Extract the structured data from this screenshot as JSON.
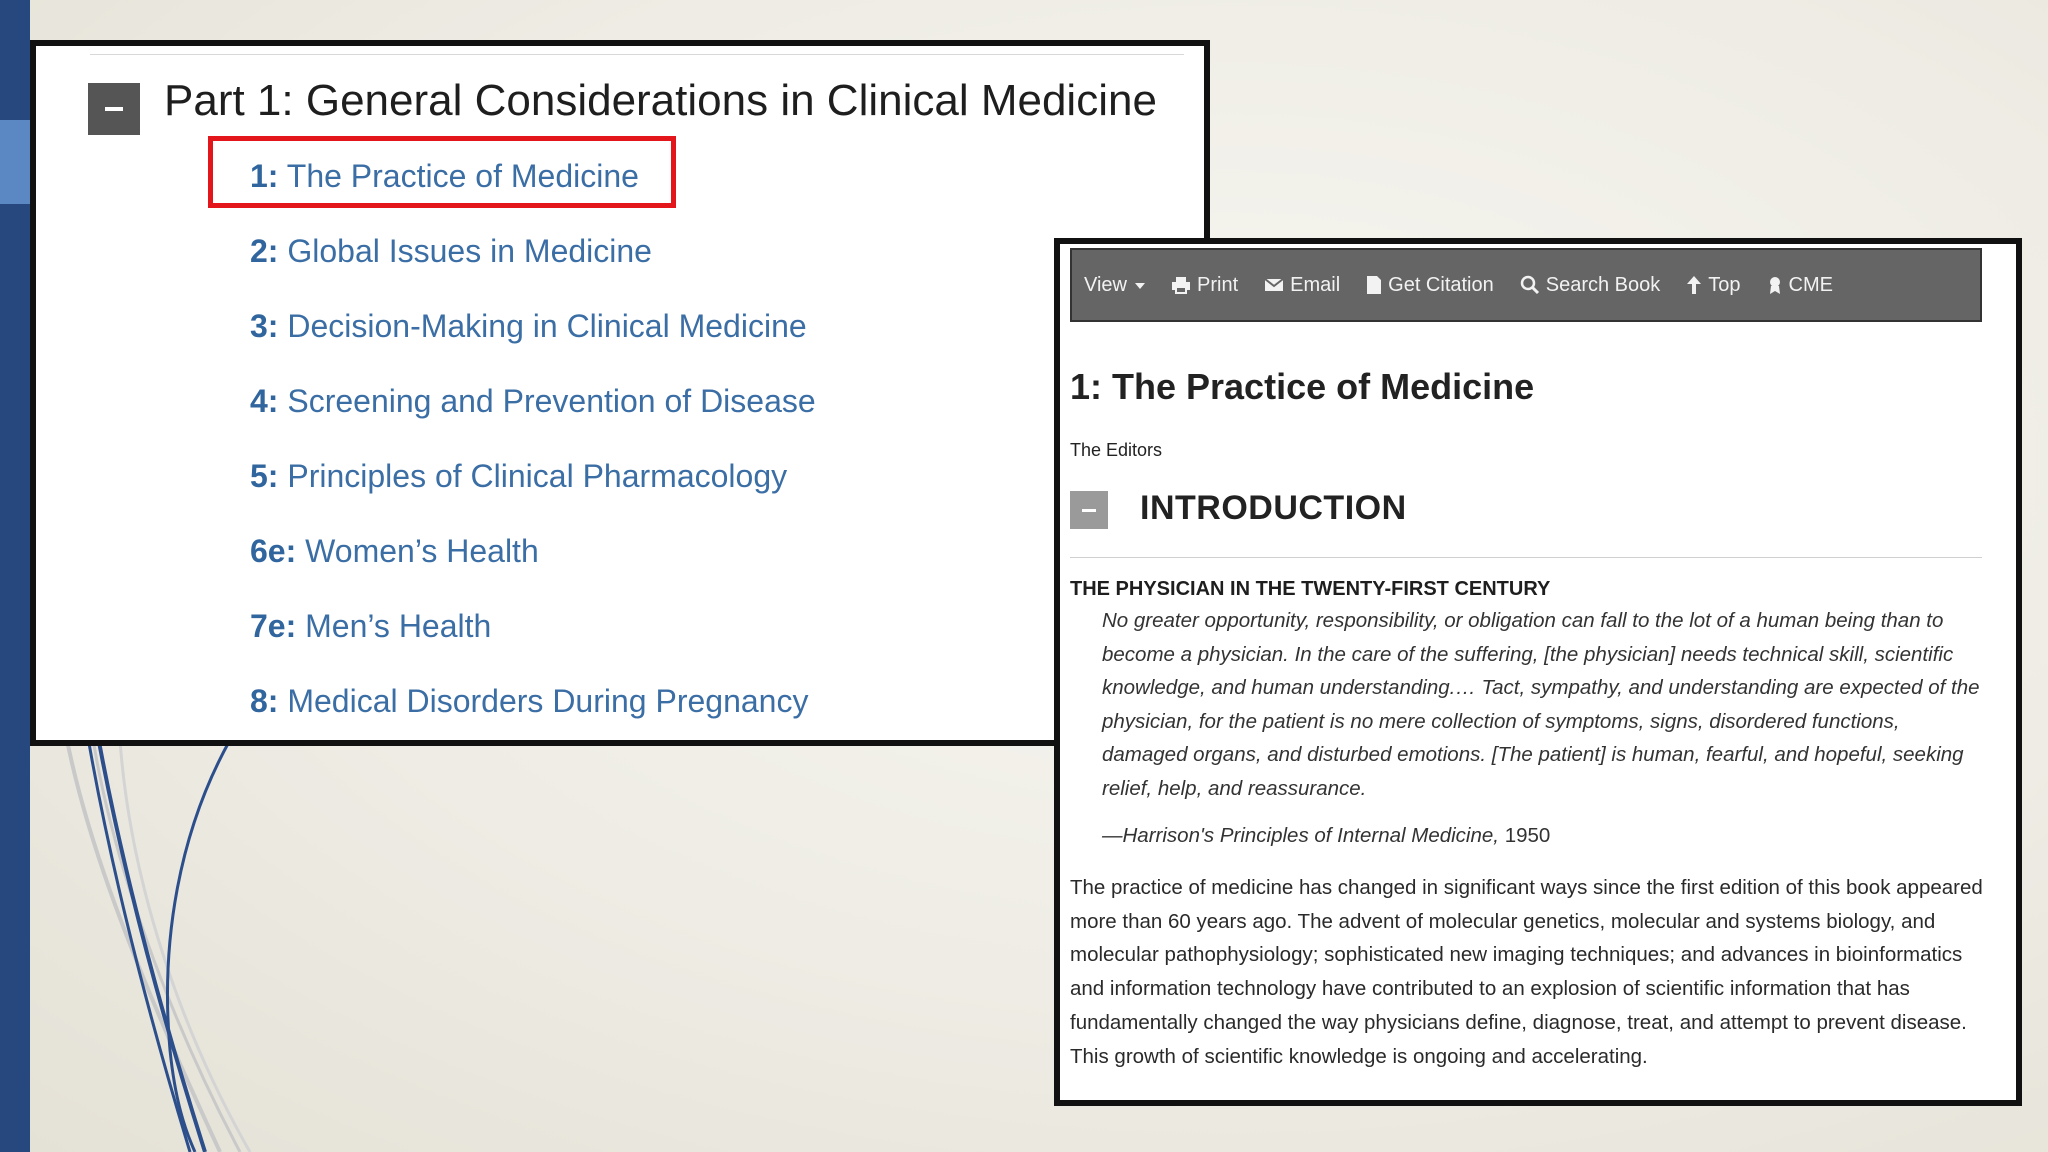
{
  "toc": {
    "part_title": "Part 1: General Considerations in Clinical Medicine",
    "chapters": [
      {
        "num": "1:",
        "title": "The Practice of Medicine"
      },
      {
        "num": "2:",
        "title": "Global Issues in Medicine"
      },
      {
        "num": "3:",
        "title": "Decision-Making in Clinical Medicine"
      },
      {
        "num": "4:",
        "title": "Screening and Prevention of Disease"
      },
      {
        "num": "5:",
        "title": "Principles of Clinical Pharmacology"
      },
      {
        "num": "6e:",
        "title": "Women’s Health"
      },
      {
        "num": "7e:",
        "title": "Men’s Health"
      },
      {
        "num": "8:",
        "title": "Medical Disorders During Pregnancy"
      }
    ],
    "highlight_color": "#e2161b"
  },
  "toolbar": {
    "view": "View",
    "print": "Print",
    "email": "Email",
    "citation": "Get Citation",
    "search": "Search Book",
    "top": "Top",
    "cme": "CME"
  },
  "article": {
    "title": "1: The Practice of Medicine",
    "author": "The Editors",
    "section_title": "INTRODUCTION",
    "subsection": "THE PHYSICIAN IN THE TWENTY-FIRST CENTURY",
    "quote": "No greater opportunity, responsibility, or obligation can fall to the lot of a human being than to become a physician. In the care of the suffering, [the physician] needs technical skill, scientific knowledge, and human understanding.… Tact, sympathy, and understanding are expected of the physician, for the patient is no mere collection of symptoms, signs, disordered functions, damaged organs, and disturbed emotions. [The patient] is human, fearful, and hopeful, seeking relief, help, and reassurance.",
    "attribution": "—Harrison's Principles of Internal Medicine,",
    "attribution_year": " 1950",
    "body": "The practice of medicine has changed in significant ways since the first edition of this book appeared more than 60 years ago. The advent of molecular genetics, molecular and systems biology, and molecular pathophysiology; sophisticated new imaging techniques; and advances in bioinformatics and information technology have contributed to an explosion of scientific information that has fundamentally changed the way physicians define, diagnose, treat, and attempt to prevent disease. This growth of scientific knowledge is ongoing and accelerating."
  },
  "colors": {
    "link": "#3b6ea5",
    "toolbar_bg": "#656565",
    "slide_accent": "#26487e"
  }
}
